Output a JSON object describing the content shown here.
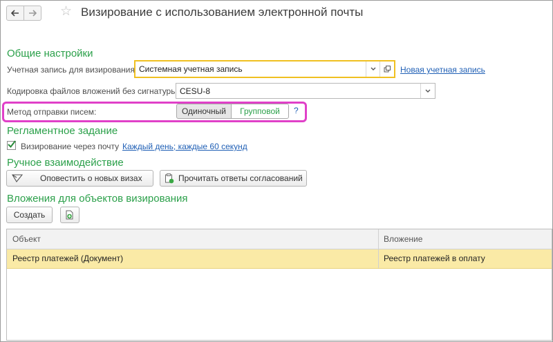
{
  "window": {
    "title": "Визирование с использованием электронной почты",
    "back_icon": "arrow-left-icon",
    "forward_icon": "arrow-right-icon",
    "favorite_icon": "star-icon"
  },
  "general": {
    "heading": "Общие настройки",
    "account_label": "Учетная запись для визирования:",
    "account_value": "Системная учетная запись",
    "new_account_link": "Новая учетная запись",
    "encoding_label": "Кодировка файлов вложений без сигнатуры:",
    "encoding_value": "CESU-8",
    "send_method_label": "Метод отправки писем:",
    "send_method_options": [
      "Одиночный",
      "Групповой"
    ],
    "send_method_selected": "Одиночный",
    "help": "?"
  },
  "scheduled": {
    "heading": "Регламентное задание",
    "checkbox_label": "Визирование через почту",
    "checkbox_checked": true,
    "schedule_link": "Каждый день; каждые 60 секунд"
  },
  "manual": {
    "heading": "Ручное взаимодействие",
    "notify_button": "Оповестить о новых визах",
    "read_button": "Прочитать ответы согласований"
  },
  "attachments": {
    "heading": "Вложения для объектов визирования",
    "create_button": "Создать",
    "columns": [
      "Объект",
      "Вложение"
    ],
    "rows": [
      [
        "Реестр платежей (Документ)",
        "Реестр платежей в оплату"
      ]
    ]
  },
  "colors": {
    "section_green": "#2ba04a",
    "link_blue": "#1f5fb5",
    "highlight_magenta": "#e040c8",
    "focus_yellow": "#f0c020",
    "row_selected": "#faeaa6"
  }
}
